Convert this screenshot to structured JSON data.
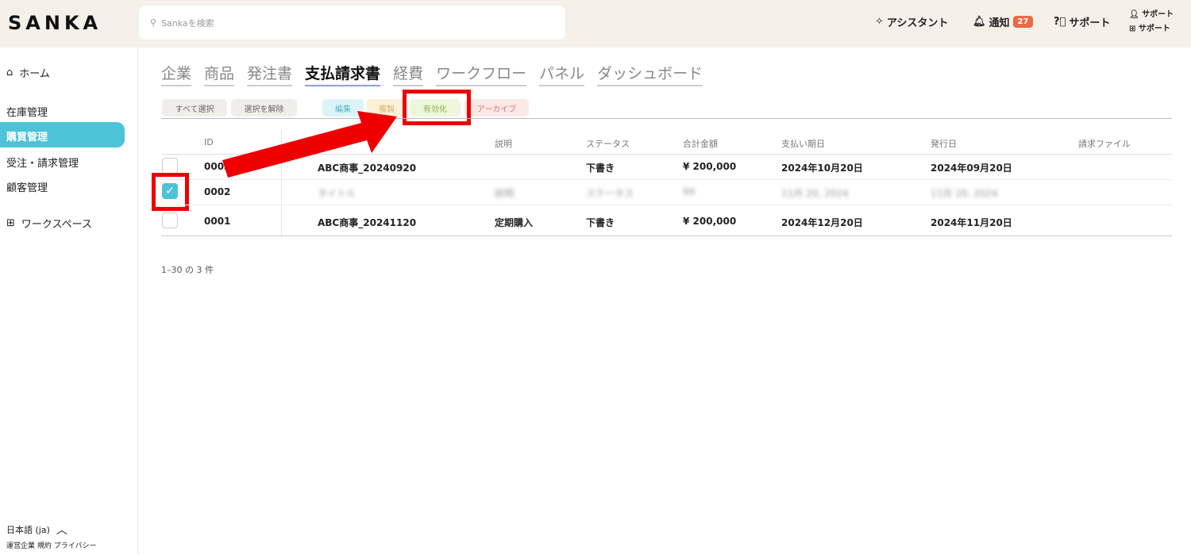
{
  "header": {
    "logo": "SANKA",
    "search_placeholder": "Sankaを検索",
    "assistant": "アシスタント",
    "notifications": "通知",
    "notification_count": "27",
    "support": "サポート",
    "user_line1": "サポート",
    "user_line2": "サポート"
  },
  "sidebar": {
    "home": "ホーム",
    "items": [
      "在庫管理",
      "購買管理",
      "受注・請求管理",
      "顧客管理"
    ],
    "workspace": "ワークスペース",
    "language": "日本語 (ja)",
    "footer": "運営企業 規約 プライバシー"
  },
  "tabs": [
    "企業",
    "商品",
    "発注書",
    "支払請求書",
    "経費",
    "ワークフロー",
    "パネル",
    "ダッシュボード"
  ],
  "active_tab": "支払請求書",
  "toolbar": {
    "select_all": "すべて選択",
    "deselect": "選択を解除",
    "edit": "編集",
    "duplicate": "複製",
    "activate": "有効化",
    "archive": "アーカイブ"
  },
  "table": {
    "headers": [
      "ID",
      "説明",
      "ステータス",
      "合計金額",
      "支払い期日",
      "発行日",
      "請求ファイル"
    ],
    "rows": [
      {
        "id": "0003",
        "title": "ABC商事_20240920",
        "desc": "",
        "status": "下書き",
        "total": "¥ 200,000",
        "due": "2024年10月20日",
        "issued": "2024年09月20日",
        "checked": false
      },
      {
        "id": "0002",
        "title": "タイトル",
        "desc": "説明",
        "status": "ステータス",
        "total": "99",
        "due": "11月 20, 2024",
        "issued": "11月 20, 2024",
        "checked": true
      },
      {
        "id": "0001",
        "title": "ABC商事_20241120",
        "desc": "定期購入",
        "status": "下書き",
        "total": "¥ 200,000",
        "due": "2024年12月20日",
        "issued": "2024年11月20日",
        "checked": false
      }
    ]
  },
  "pagination": "1–30 の 3 件"
}
